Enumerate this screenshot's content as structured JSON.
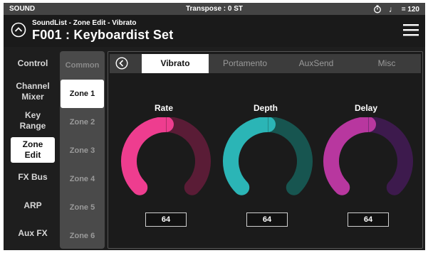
{
  "statusbar": {
    "mode": "SOUND",
    "transpose": "Transpose : 0 ST",
    "tempo": "= 120",
    "icons": {
      "tempo_dial": "timer-icon",
      "note": "quarter-note-icon"
    }
  },
  "header": {
    "breadcrumb": "SoundList - Zone Edit - Vibrato",
    "title": "F001 : Keyboardist Set",
    "icons": {
      "back": "circle-chevron-up-icon",
      "menu": "hamburger-menu-icon"
    }
  },
  "nav": {
    "items": [
      {
        "label": "Control",
        "active": false
      },
      {
        "label": "Channel\nMixer",
        "active": false
      },
      {
        "label": "Key\nRange",
        "active": false
      },
      {
        "label": "Zone\nEdit",
        "active": true
      },
      {
        "label": "FX Bus",
        "active": false
      },
      {
        "label": "ARP",
        "active": false
      },
      {
        "label": "Aux FX",
        "active": false
      }
    ]
  },
  "zones": {
    "items": [
      {
        "label": "Common",
        "active": false
      },
      {
        "label": "Zone 1",
        "active": true
      },
      {
        "label": "Zone 2",
        "active": false
      },
      {
        "label": "Zone 3",
        "active": false
      },
      {
        "label": "Zone 4",
        "active": false
      },
      {
        "label": "Zone 5",
        "active": false
      },
      {
        "label": "Zone 6",
        "active": false
      }
    ]
  },
  "tabs": {
    "back_icon": "circle-chevron-left-icon",
    "items": [
      {
        "label": "Vibrato",
        "active": true
      },
      {
        "label": "Portamento",
        "active": false
      },
      {
        "label": "AuxSend",
        "active": false
      },
      {
        "label": "Misc",
        "active": false
      }
    ]
  },
  "knobs": [
    {
      "label": "Rate",
      "value": "64",
      "level": 0.5,
      "color_on": "#ee3d8f",
      "color_off": "#5a1c36"
    },
    {
      "label": "Depth",
      "value": "64",
      "level": 0.5,
      "color_on": "#2bb5b6",
      "color_off": "#175550"
    },
    {
      "label": "Delay",
      "value": "64",
      "level": 0.5,
      "color_on": "#b8379f",
      "color_off": "#3d1a4d"
    }
  ]
}
